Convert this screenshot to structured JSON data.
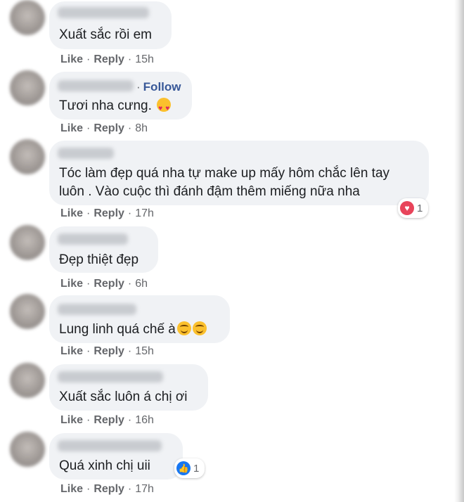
{
  "comments": [
    {
      "text": "Xuất sắc rồi em",
      "like": "Like",
      "reply": "Reply",
      "time": "15h",
      "avatar": "blurred-avatar"
    },
    {
      "follow": "Follow",
      "text": "Tươi nha cưng.",
      "emoji": "heart-eyes",
      "like": "Like",
      "reply": "Reply",
      "time": "8h"
    },
    {
      "text_line1": "Tóc làm đẹp quá nha tự make up mấy hôm chắc lên tay",
      "text_line2": "luôn . Vào cuộc thì đánh đậm thêm miếng nữa nha",
      "like": "Like",
      "reply": "Reply",
      "time": "17h",
      "reaction": {
        "icon": "love-icon",
        "count": "1"
      }
    },
    {
      "text": "Đẹp thiệt đẹp",
      "like": "Like",
      "reply": "Reply",
      "time": "6h"
    },
    {
      "text": "Lung linh quá chế à",
      "emoji": "smile",
      "like": "Like",
      "reply": "Reply",
      "time": "15h"
    },
    {
      "text": "Xuất sắc luôn á chị ơi",
      "like": "Like",
      "reply": "Reply",
      "time": "16h"
    },
    {
      "text": "Quá xinh chị uii",
      "like": "Like",
      "reply": "Reply",
      "time": "17h",
      "reaction": {
        "icon": "like-icon",
        "count": "1"
      }
    }
  ],
  "colors": {
    "bubble": "#f0f2f5",
    "link": "#385898",
    "love": "#e8445a",
    "like": "#1877f2"
  }
}
